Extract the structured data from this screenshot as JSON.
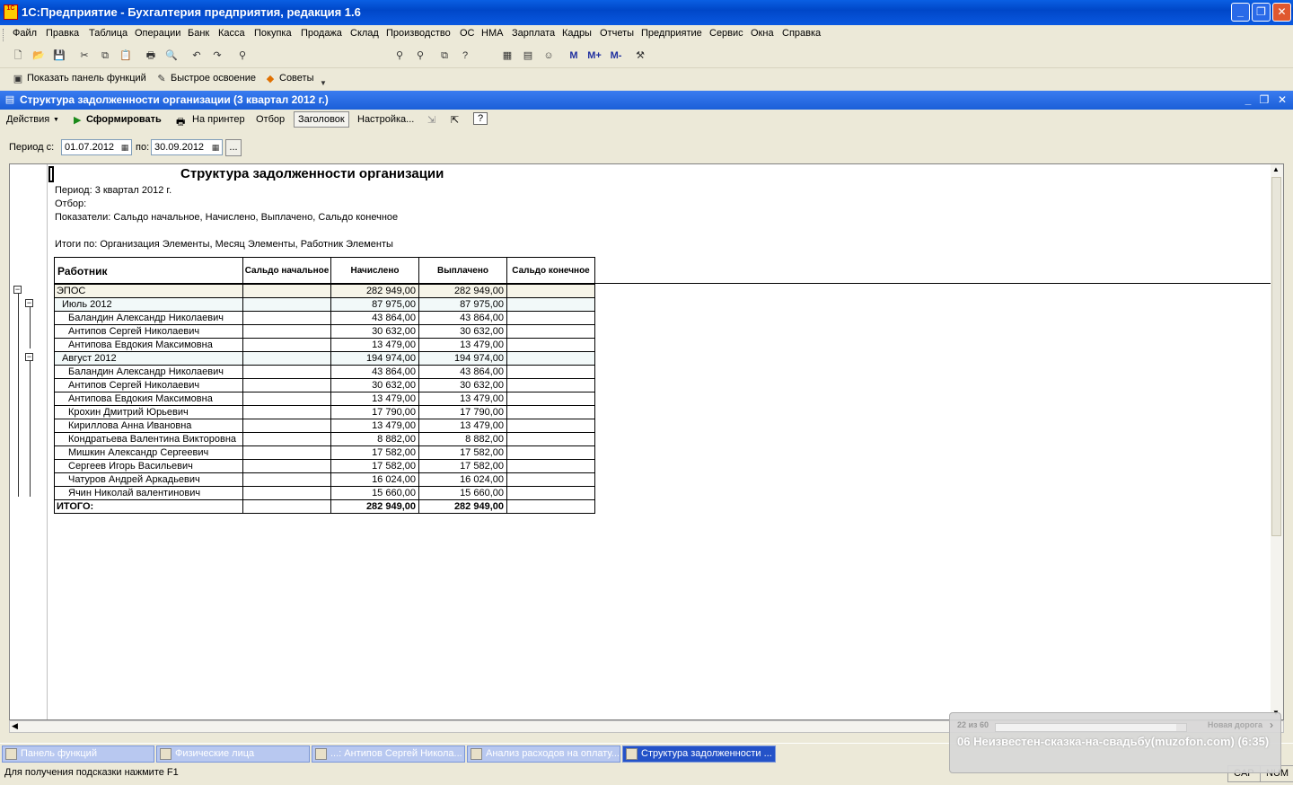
{
  "app": {
    "title": "1С:Предприятие - Бухгалтерия предприятия, редакция 1.6",
    "icon_label": "1С"
  },
  "menu": [
    "Файл",
    "Правка",
    "Таблица",
    "Операции",
    "Банк",
    "Касса",
    "Покупка",
    "Продажа",
    "Склад",
    "Производство",
    "ОС",
    "НМА",
    "Зарплата",
    "Кадры",
    "Отчеты",
    "Предприятие",
    "Сервис",
    "Окна",
    "Справка"
  ],
  "toolbar": {
    "search_value": "",
    "m_buttons": [
      "M",
      "M+",
      "M-"
    ]
  },
  "toolbar2": {
    "show_panel": "Показать панель функций",
    "quick_start": "Быстрое освоение",
    "tips": "Советы"
  },
  "child": {
    "title": "Структура задолженности организации (3 квартал 2012 г.)",
    "actions": "Действия",
    "generate": "Сформировать",
    "print": "На принтер",
    "filter": "Отбор",
    "header": "Заголовок",
    "settings": "Настройка...",
    "help": "?"
  },
  "period": {
    "from_label": "Период с:",
    "from": "01.07.2012",
    "to_label": "по:",
    "to": "30.09.2012",
    "more": "..."
  },
  "report": {
    "title": "Структура задолженности организации",
    "period": "Период: 3 квартал 2012 г.",
    "filter": "Отбор:",
    "indicators": "Показатели:  Сальдо начальное, Начислено, Выплачено, Сальдо конечное",
    "totals": "Итоги по:  Организация Элементы, Месяц Элементы, Работник Элементы",
    "headers": {
      "worker": "Работник",
      "saldo_start": "Сальдо начальное",
      "accrued": "Начислено",
      "paid": "Выплачено",
      "saldo_end": "Сальдо конечное"
    },
    "rows": [
      {
        "name": "ЭПОС",
        "level": 0,
        "start": "",
        "accrued": "282 949,00",
        "paid": "282 949,00",
        "end": ""
      },
      {
        "name": "Июль 2012",
        "level": 1,
        "start": "",
        "accrued": "87 975,00",
        "paid": "87 975,00",
        "end": ""
      },
      {
        "name": "Баландин Александр Николаевич",
        "level": 2,
        "start": "",
        "accrued": "43 864,00",
        "paid": "43 864,00",
        "end": ""
      },
      {
        "name": "Антипов Сергей Николаевич",
        "level": 2,
        "start": "",
        "accrued": "30 632,00",
        "paid": "30 632,00",
        "end": ""
      },
      {
        "name": "Антипова Евдокия  Максимовна",
        "level": 2,
        "start": "",
        "accrued": "13 479,00",
        "paid": "13 479,00",
        "end": ""
      },
      {
        "name": "Август 2012",
        "level": 1,
        "start": "",
        "accrued": "194 974,00",
        "paid": "194 974,00",
        "end": ""
      },
      {
        "name": "Баландин Александр Николаевич",
        "level": 2,
        "start": "",
        "accrued": "43 864,00",
        "paid": "43 864,00",
        "end": ""
      },
      {
        "name": "Антипов Сергей Николаевич",
        "level": 2,
        "start": "",
        "accrued": "30 632,00",
        "paid": "30 632,00",
        "end": ""
      },
      {
        "name": "Антипова Евдокия  Максимовна",
        "level": 2,
        "start": "",
        "accrued": "13 479,00",
        "paid": "13 479,00",
        "end": ""
      },
      {
        "name": "Крохин Дмитрий Юрьевич",
        "level": 2,
        "start": "",
        "accrued": "17 790,00",
        "paid": "17 790,00",
        "end": ""
      },
      {
        "name": "Кириллова Анна Ивановна",
        "level": 2,
        "start": "",
        "accrued": "13 479,00",
        "paid": "13 479,00",
        "end": ""
      },
      {
        "name": "Кондратьева Валентина Викторовна",
        "level": 2,
        "start": "",
        "accrued": "8 882,00",
        "paid": "8 882,00",
        "end": ""
      },
      {
        "name": "Мишкин Александр Сергеевич",
        "level": 2,
        "start": "",
        "accrued": "17 582,00",
        "paid": "17 582,00",
        "end": ""
      },
      {
        "name": "Сергеев  Игорь Васильевич",
        "level": 2,
        "start": "",
        "accrued": "17 582,00",
        "paid": "17 582,00",
        "end": ""
      },
      {
        "name": "Чатуров  Андрей Аркадьевич",
        "level": 2,
        "start": "",
        "accrued": "16 024,00",
        "paid": "16 024,00",
        "end": ""
      },
      {
        "name": "Ячин Николай валентинович",
        "level": 2,
        "start": "",
        "accrued": "15 660,00",
        "paid": "15 660,00",
        "end": ""
      },
      {
        "name": "ИТОГО:",
        "level": -1,
        "start": "",
        "accrued": "282 949,00",
        "paid": "282 949,00",
        "end": ""
      }
    ]
  },
  "taskbar": [
    "Панель функций",
    "Физические лица",
    "...: Антипов Сергей Никола...",
    "Анализ расходов на оплату...",
    "Структура задолженности ..."
  ],
  "status": {
    "hint": "Для получения подсказки нажмите F1",
    "cap": "CAP",
    "num": "NUM"
  },
  "player": {
    "count": "22 из 60",
    "station": "Новая дорога",
    "track": "06 Неизвестен-сказка-на-свадьбу(muzofon.com) (6:35)",
    "progress": 0.95
  }
}
